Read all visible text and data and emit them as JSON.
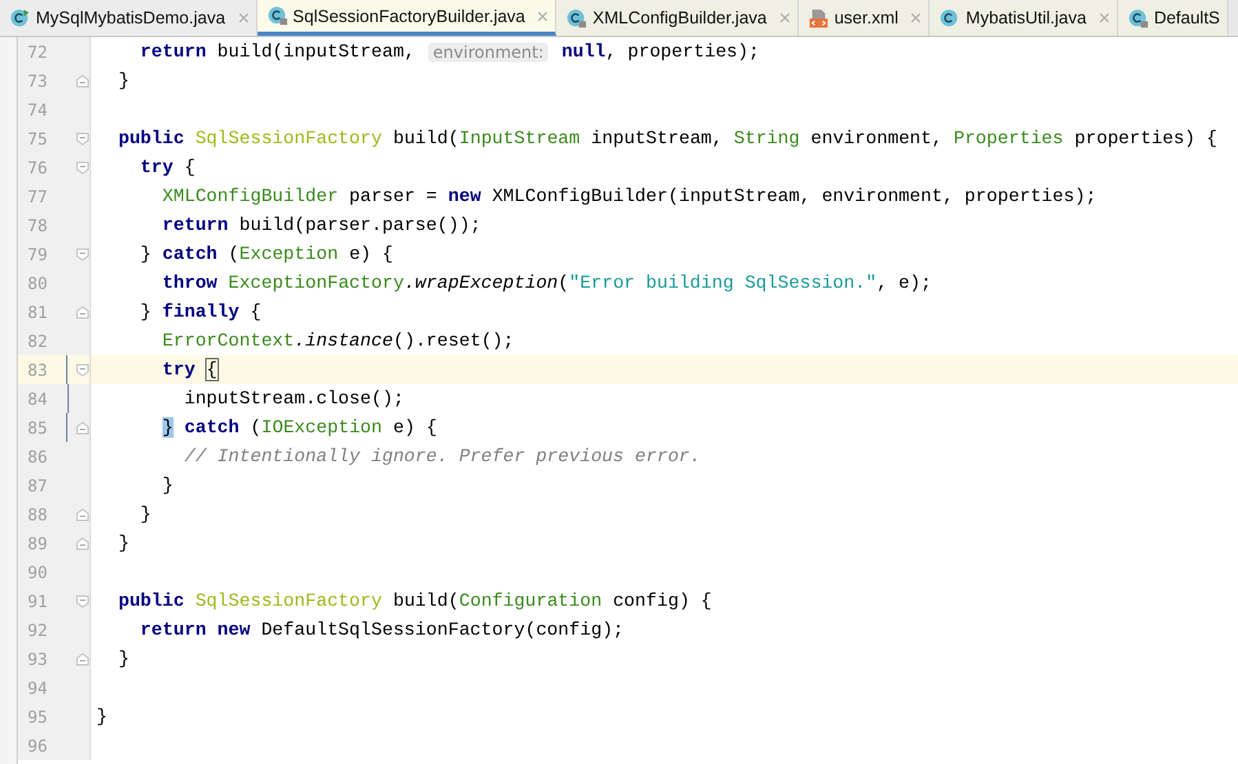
{
  "tabs": [
    {
      "label": "MySqlMybatisDemo.java",
      "kind": "runnable",
      "selected": false,
      "closable": true
    },
    {
      "label": "SqlSessionFactoryBuilder.java",
      "kind": "locked",
      "selected": true,
      "closable": true
    },
    {
      "label": "XMLConfigBuilder.java",
      "kind": "locked",
      "selected": false,
      "closable": true
    },
    {
      "label": "user.xml",
      "kind": "xml",
      "selected": false,
      "closable": true
    },
    {
      "label": "MybatisUtil.java",
      "kind": "class",
      "selected": false,
      "closable": true
    },
    {
      "label": "DefaultS",
      "kind": "locked",
      "selected": false,
      "closable": false
    }
  ],
  "editor": {
    "lines": [
      {
        "number": "72",
        "kind": "plain",
        "current": false,
        "changed": false,
        "tokens": [
          {
            "kind": "kw",
            "text": "    return"
          },
          {
            "kind": "plain",
            "text": " build(inputStream, "
          },
          {
            "kind": "hint",
            "text": "environment:"
          },
          {
            "kind": "kw",
            "text": " null"
          },
          {
            "kind": "plain",
            "text": ", properties);"
          }
        ]
      },
      {
        "number": "73",
        "kind": "closing",
        "current": false,
        "changed": false,
        "tokens": [
          {
            "kind": "plain",
            "text": "  }"
          }
        ]
      },
      {
        "number": "74",
        "kind": "plain",
        "current": false,
        "changed": false
      },
      {
        "number": "75",
        "kind": "opening",
        "current": false,
        "changed": false,
        "tokens": [
          {
            "kind": "kw",
            "text": "  public "
          },
          {
            "kind": "type2",
            "text": "SqlSessionFactory"
          },
          {
            "kind": "plain",
            "text": " build("
          },
          {
            "kind": "type",
            "text": "InputStream"
          },
          {
            "kind": "plain",
            "text": " inputStream, "
          },
          {
            "kind": "type",
            "text": "String"
          },
          {
            "kind": "plain",
            "text": " environment, "
          },
          {
            "kind": "type",
            "text": "Properties"
          },
          {
            "kind": "plain",
            "text": " properties) {"
          }
        ]
      },
      {
        "number": "76",
        "kind": "opening",
        "current": false,
        "changed": false,
        "tokens": [
          {
            "kind": "kw",
            "text": "    try"
          },
          {
            "kind": "plain",
            "text": " {"
          }
        ]
      },
      {
        "number": "77",
        "kind": "plain",
        "current": false,
        "changed": false,
        "tokens": [
          {
            "kind": "type",
            "text": "      XMLConfigBuilder"
          },
          {
            "kind": "plain",
            "text": " parser = "
          },
          {
            "kind": "kw",
            "text": "new"
          },
          {
            "kind": "plain",
            "text": " XMLConfigBuilder(inputStream, environment, properties);"
          }
        ]
      },
      {
        "number": "78",
        "kind": "plain",
        "current": false,
        "changed": false,
        "tokens": [
          {
            "kind": "kw",
            "text": "      return"
          },
          {
            "kind": "plain",
            "text": " build(parser.parse());"
          }
        ]
      },
      {
        "number": "79",
        "kind": "opening",
        "current": false,
        "changed": false,
        "tokens": [
          {
            "kind": "plain",
            "text": "    } "
          },
          {
            "kind": "kw",
            "text": "catch"
          },
          {
            "kind": "plain",
            "text": " ("
          },
          {
            "kind": "type",
            "text": "Exception"
          },
          {
            "kind": "plain",
            "text": " e) {"
          }
        ]
      },
      {
        "number": "80",
        "kind": "plain",
        "current": false,
        "changed": false,
        "tokens": [
          {
            "kind": "kw",
            "text": "      throw "
          },
          {
            "kind": "type",
            "text": "ExceptionFactory"
          },
          {
            "kind": "italic",
            "text": ".wrapException"
          },
          {
            "kind": "plain",
            "text": "("
          },
          {
            "kind": "str",
            "text": "\"Error building SqlSession.\""
          },
          {
            "kind": "plain",
            "text": ", e);"
          }
        ]
      },
      {
        "number": "81",
        "kind": "closing",
        "current": false,
        "changed": false,
        "tokens": [
          {
            "kind": "plain",
            "text": "    } "
          },
          {
            "kind": "kw",
            "text": "finally"
          },
          {
            "kind": "plain",
            "text": " {"
          }
        ]
      },
      {
        "number": "82",
        "kind": "plain",
        "current": false,
        "changed": false,
        "tokens": [
          {
            "kind": "type",
            "text": "      ErrorContext"
          },
          {
            "kind": "italic",
            "text": ".instance"
          },
          {
            "kind": "plain",
            "text": "().reset();"
          }
        ]
      },
      {
        "number": "83",
        "kind": "opening",
        "current": true,
        "changed": true,
        "tokens": [
          {
            "kind": "kw",
            "text": "      try "
          },
          {
            "kind": "match",
            "text": "{"
          }
        ]
      },
      {
        "number": "84",
        "kind": "plain",
        "current": false,
        "changed": true,
        "tokens": [
          {
            "kind": "plain",
            "text": "        inputStream.close();"
          }
        ]
      },
      {
        "number": "85",
        "kind": "closing",
        "current": false,
        "changed": true,
        "tokens": [
          {
            "kind": "match2",
            "text": "      }"
          },
          {
            "kind": "kw",
            "text": " catch"
          },
          {
            "kind": "plain",
            "text": " ("
          },
          {
            "kind": "type",
            "text": "IOException"
          },
          {
            "kind": "plain",
            "text": " e) {"
          }
        ]
      },
      {
        "number": "86",
        "kind": "plain",
        "current": false,
        "changed": false,
        "tokens": [
          {
            "kind": "comment",
            "text": "        // Intentionally ignore. Prefer previous error."
          }
        ]
      },
      {
        "number": "87",
        "kind": "plain",
        "current": false,
        "changed": false,
        "tokens": [
          {
            "kind": "plain",
            "text": "      }"
          }
        ]
      },
      {
        "number": "88",
        "kind": "closing",
        "current": false,
        "changed": false,
        "tokens": [
          {
            "kind": "plain",
            "text": "    }"
          }
        ]
      },
      {
        "number": "89",
        "kind": "closing",
        "current": false,
        "changed": false,
        "tokens": [
          {
            "kind": "plain",
            "text": "  }"
          }
        ]
      },
      {
        "number": "90",
        "kind": "plain",
        "current": false,
        "changed": false
      },
      {
        "number": "91",
        "kind": "opening",
        "current": false,
        "changed": false,
        "tokens": [
          {
            "kind": "kw",
            "text": "  public "
          },
          {
            "kind": "type2",
            "text": "SqlSessionFactory"
          },
          {
            "kind": "plain",
            "text": " build("
          },
          {
            "kind": "type",
            "text": "Configuration"
          },
          {
            "kind": "plain",
            "text": " config) {"
          }
        ]
      },
      {
        "number": "92",
        "kind": "plain",
        "current": false,
        "changed": false,
        "tokens": [
          {
            "kind": "kw",
            "text": "    return new"
          },
          {
            "kind": "plain",
            "text": " DefaultSqlSessionFactory(config);"
          }
        ]
      },
      {
        "number": "93",
        "kind": "closing",
        "current": false,
        "changed": false,
        "tokens": [
          {
            "kind": "plain",
            "text": "  }"
          }
        ]
      },
      {
        "number": "94",
        "kind": "plain",
        "current": false,
        "changed": false
      },
      {
        "number": "95",
        "kind": "plain",
        "current": false,
        "changed": false,
        "tokens": [
          {
            "kind": "plain",
            "text": "}"
          }
        ]
      },
      {
        "number": "96",
        "kind": "plain",
        "current": false,
        "changed": false
      }
    ]
  }
}
